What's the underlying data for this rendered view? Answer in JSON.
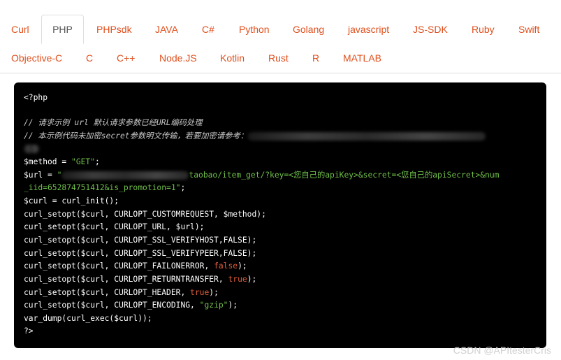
{
  "tabs": {
    "row1": [
      "Curl",
      "PHP",
      "PHPsdk",
      "JAVA",
      "C#",
      "Python",
      "Golang",
      "javascript",
      "JS-SDK",
      "Ruby",
      "Swift"
    ],
    "row2": [
      "Objective-C",
      "C",
      "C++",
      "Node.JS",
      "Kotlin",
      "Rust",
      "R",
      "MATLAB"
    ],
    "active": "PHP"
  },
  "code": {
    "open_tag": "<?php",
    "comment1": "// 请求示例 url 默认请求参数已经URL编码处理",
    "comment2": "// 本示例代码未加密secret参数明文传输，若要加密请参考：",
    "method_prefix": "$method = ",
    "method_value": "\"GET\"",
    "method_suffix": ";",
    "url_prefix": "$url = ",
    "url_quote": "\"",
    "url_visible": "taobao/item_get/?key=<您自己的apiKey>&secret=<您自己的apiSecret>&num",
    "url_line2": "_iid=652874751412&is_promotion=1\"",
    "url_line2_suffix": ";",
    "init": "$curl = curl_init();",
    "setopt1_prefix": "curl_setopt($curl, CURLOPT_CUSTOMREQUEST, $method);",
    "setopt2": "curl_setopt($curl, CURLOPT_URL, $url);",
    "setopt3": "curl_setopt($curl, CURLOPT_SSL_VERIFYHOST,FALSE);",
    "setopt4": "curl_setopt($curl, CURLOPT_SSL_VERIFYPEER,FALSE);",
    "setopt5_prefix": "curl_setopt($curl, CURLOPT_FAILONERROR, ",
    "setopt5_value": "false",
    "setopt6_prefix": "curl_setopt($curl, CURLOPT_RETURNTRANSFER, ",
    "setopt6_value": "true",
    "setopt7_prefix": "curl_setopt($curl, CURLOPT_HEADER, ",
    "setopt7_value": "true",
    "setopt8_prefix": "curl_setopt($curl, CURLOPT_ENCODING, ",
    "setopt8_value": "\"gzip\"",
    "stmt_end": ");",
    "dump": "var_dump(curl_exec($curl));",
    "close_tag": "?>"
  },
  "watermark": "CSDN @APItesterCris",
  "colors": {
    "tab_link": "#e0501e",
    "code_bg": "#000000",
    "string": "#6fbf4a",
    "keyword": "#e05c3a"
  }
}
